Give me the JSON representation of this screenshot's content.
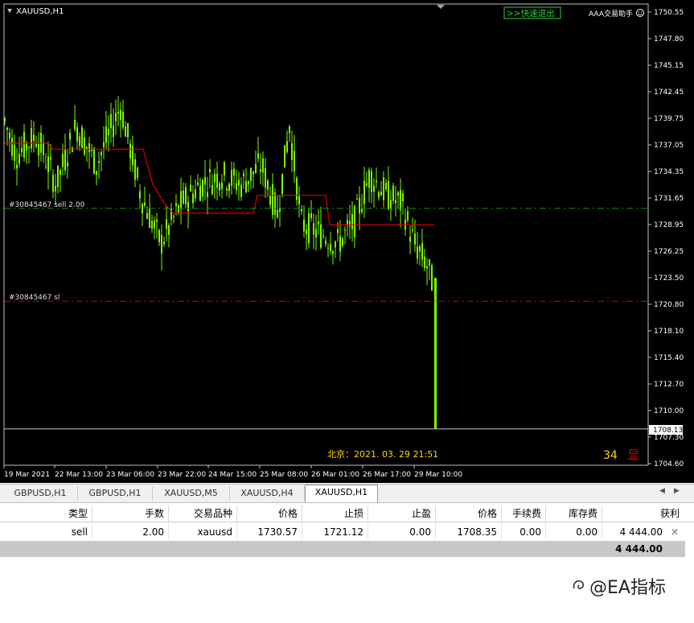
{
  "chart": {
    "title": "XAUUSD,H1",
    "exit_button": ">>快速退出",
    "ea_name": "AAA交易助手",
    "ea_icon": "smiley-icon",
    "order_line_label": "#30845467 sell 2.00",
    "sl_line_label": "#30845467 sl",
    "time_readout": "北京：2021. 03. 29  21:51",
    "count": "34",
    "count_label": "显",
    "current_price": "1708.13",
    "colors": {
      "candles": "#7CFC00",
      "ma_line": "#e00000",
      "order_line": "#00a000",
      "sl_line": "#d00000",
      "axis_text": "#ffffff",
      "time_readout": "#ffd700",
      "count": "#ffd700",
      "count_label": "#e00000"
    },
    "price_axis": [
      "1750.55",
      "1747.80",
      "1745.15",
      "1742.45",
      "1739.75",
      "1737.05",
      "1734.35",
      "1731.65",
      "1728.95",
      "1726.25",
      "1723.50",
      "1720.80",
      "1718.10",
      "1715.40",
      "1712.70",
      "1710.00",
      "1707.30",
      "1704.60"
    ],
    "time_axis": [
      "19 Mar 2021",
      "22 Mar 13:00",
      "23 Mar 06:00",
      "23 Mar 22:00",
      "24 Mar 15:00",
      "25 Mar 08:00",
      "26 Mar 01:00",
      "26 Mar 17:00",
      "29 Mar 10:00"
    ]
  },
  "tabs": [
    "GBPUSD,H1",
    "GBPUSD,H1",
    "XAUUSD,M5",
    "XAUUSD,H4",
    "XAUUSD,H1"
  ],
  "active_tab": 4,
  "table": {
    "headers": [
      "类型",
      "手数",
      "交易品种",
      "价格",
      "止损",
      "止盈",
      "价格",
      "手续费",
      "库存费",
      "获利"
    ],
    "rows": [
      [
        "sell",
        "2.00",
        "xauusd",
        "1730.57",
        "1721.12",
        "0.00",
        "1708.35",
        "0.00",
        "0.00",
        "4 444.00"
      ]
    ],
    "total": "4 444.00"
  },
  "watermark": "@EA指标"
}
